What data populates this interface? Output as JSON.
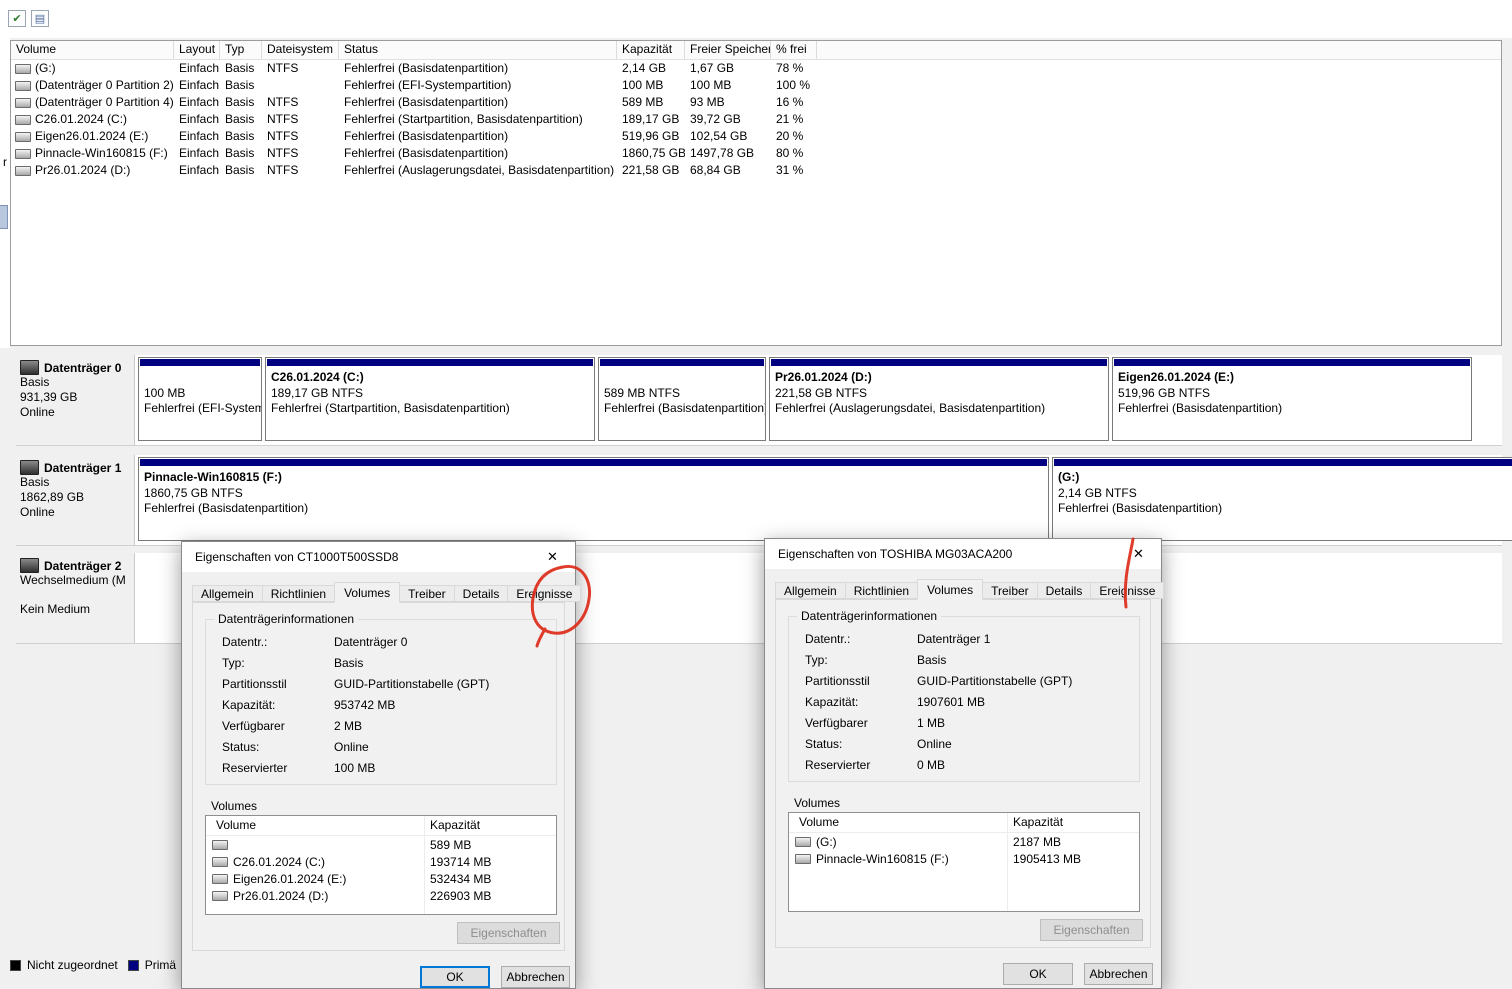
{
  "icons": {
    "toolbar_check": "✔",
    "toolbar_form": "▤",
    "close": "✕"
  },
  "fragments": {
    "left_text": "r"
  },
  "volume_table": {
    "columns": [
      "Volume",
      "Layout",
      "Typ",
      "Dateisystem",
      "Status",
      "Kapazität",
      "Freier Speicher",
      "% frei"
    ],
    "rows": [
      {
        "name": "(G:)",
        "layout": "Einfach",
        "typ": "Basis",
        "fs": "NTFS",
        "status": "Fehlerfrei (Basisdatenpartition)",
        "kap": "2,14 GB",
        "frei": "1,67 GB",
        "pct": "78 %"
      },
      {
        "name": "(Datenträger 0 Partition 2)",
        "layout": "Einfach",
        "typ": "Basis",
        "fs": "",
        "status": "Fehlerfrei (EFI-Systempartition)",
        "kap": "100 MB",
        "frei": "100 MB",
        "pct": "100 %"
      },
      {
        "name": "(Datenträger 0 Partition 4)",
        "layout": "Einfach",
        "typ": "Basis",
        "fs": "NTFS",
        "status": "Fehlerfrei (Basisdatenpartition)",
        "kap": "589 MB",
        "frei": "93 MB",
        "pct": "16 %"
      },
      {
        "name": "C26.01.2024 (C:)",
        "layout": "Einfach",
        "typ": "Basis",
        "fs": "NTFS",
        "status": "Fehlerfrei (Startpartition, Basisdatenpartition)",
        "kap": "189,17 GB",
        "frei": "39,72 GB",
        "pct": "21 %"
      },
      {
        "name": "Eigen26.01.2024 (E:)",
        "layout": "Einfach",
        "typ": "Basis",
        "fs": "NTFS",
        "status": "Fehlerfrei (Basisdatenpartition)",
        "kap": "519,96 GB",
        "frei": "102,54 GB",
        "pct": "20 %"
      },
      {
        "name": "Pinnacle-Win160815 (F:)",
        "layout": "Einfach",
        "typ": "Basis",
        "fs": "NTFS",
        "status": "Fehlerfrei (Basisdatenpartition)",
        "kap": "1860,75 GB",
        "frei": "1497,78 GB",
        "pct": "80 %"
      },
      {
        "name": "Pr26.01.2024 (D:)",
        "layout": "Einfach",
        "typ": "Basis",
        "fs": "NTFS",
        "status": "Fehlerfrei (Auslagerungsdatei, Basisdatenpartition)",
        "kap": "221,58 GB",
        "frei": "68,84 GB",
        "pct": "31 %"
      }
    ]
  },
  "disks": [
    {
      "name": "Datenträger 0",
      "type": "Basis",
      "size": "931,39 GB",
      "state": "Online",
      "partitions": [
        {
          "name": "",
          "size": "100 MB",
          "status": "Fehlerfrei (EFI-Systempartition)"
        },
        {
          "name": "C26.01.2024 (C:)",
          "size": "189,17 GB NTFS",
          "status": "Fehlerfrei (Startpartition, Basisdatenpartition)"
        },
        {
          "name": "",
          "size": "589 MB NTFS",
          "status": "Fehlerfrei (Basisdatenpartition)"
        },
        {
          "name": "Pr26.01.2024 (D:)",
          "size": "221,58 GB NTFS",
          "status": "Fehlerfrei (Auslagerungsdatei, Basisdatenpartition)"
        },
        {
          "name": "Eigen26.01.2024 (E:)",
          "size": "519,96 GB NTFS",
          "status": "Fehlerfrei (Basisdatenpartition)"
        }
      ]
    },
    {
      "name": "Datenträger 1",
      "type": "Basis",
      "size": "1862,89 GB",
      "state": "Online",
      "partitions": [
        {
          "name": "Pinnacle-Win160815 (F:)",
          "size": "1860,75 GB NTFS",
          "status": "Fehlerfrei (Basisdatenpartition)"
        },
        {
          "name": "(G:)",
          "size": "2,14 GB NTFS",
          "status": "Fehlerfrei (Basisdatenpartition)"
        }
      ]
    },
    {
      "name": "Datenträger 2",
      "type": "Wechselmedium (M",
      "state": "Kein Medium",
      "partitions": []
    }
  ],
  "legend": {
    "items": [
      {
        "label": "Nicht zugeordnet"
      },
      {
        "label": "Primä"
      }
    ]
  },
  "dialog1": {
    "title": "Eigenschaften von CT1000T500SSD8",
    "tabs": [
      "Allgemein",
      "Richtlinien",
      "Volumes",
      "Treiber",
      "Details",
      "Ereignisse"
    ],
    "info_title": "Datenträgerinformationen",
    "fields": [
      {
        "label": "Datentr.:",
        "value": "Datenträger 0"
      },
      {
        "label": "Typ:",
        "value": "Basis"
      },
      {
        "label": "Partitionsstil",
        "value": "GUID-Partitionstabelle (GPT)"
      },
      {
        "label": "Kapazität:",
        "value": "953742 MB"
      },
      {
        "label": "Verfügbarer",
        "value": "2 MB"
      },
      {
        "label": "Status:",
        "value": "Online"
      },
      {
        "label": "Reservierter",
        "value": "100 MB"
      }
    ],
    "volumes_title": "Volumes",
    "vol_columns": [
      "Volume",
      "Kapazität"
    ],
    "volumes": [
      {
        "name": "",
        "kap": "589 MB"
      },
      {
        "name": "C26.01.2024 (C:)",
        "kap": "193714 MB"
      },
      {
        "name": "Eigen26.01.2024 (E:)",
        "kap": "532434 MB"
      },
      {
        "name": "Pr26.01.2024 (D:)",
        "kap": "226903 MB"
      }
    ],
    "properties_btn": "Eigenschaften",
    "ok": "OK",
    "cancel": "Abbrechen"
  },
  "dialog2": {
    "title": "Eigenschaften von TOSHIBA MG03ACA200",
    "tabs": [
      "Allgemein",
      "Richtlinien",
      "Volumes",
      "Treiber",
      "Details",
      "Ereignisse"
    ],
    "info_title": "Datenträgerinformationen",
    "fields": [
      {
        "label": "Datentr.:",
        "value": "Datenträger 1"
      },
      {
        "label": "Typ:",
        "value": "Basis"
      },
      {
        "label": "Partitionsstil",
        "value": "GUID-Partitionstabelle (GPT)"
      },
      {
        "label": "Kapazität:",
        "value": "1907601 MB"
      },
      {
        "label": "Verfügbarer",
        "value": "1 MB"
      },
      {
        "label": "Status:",
        "value": "Online"
      },
      {
        "label": "Reservierter",
        "value": "0 MB"
      }
    ],
    "volumes_title": "Volumes",
    "vol_columns": [
      "Volume",
      "Kapazität"
    ],
    "volumes": [
      {
        "name": "(G:)",
        "kap": "2187 MB"
      },
      {
        "name": "Pinnacle-Win160815 (F:)",
        "kap": "1905413 MB"
      }
    ],
    "properties_btn": "Eigenschaften",
    "ok": "OK",
    "cancel": "Abbrechen"
  }
}
